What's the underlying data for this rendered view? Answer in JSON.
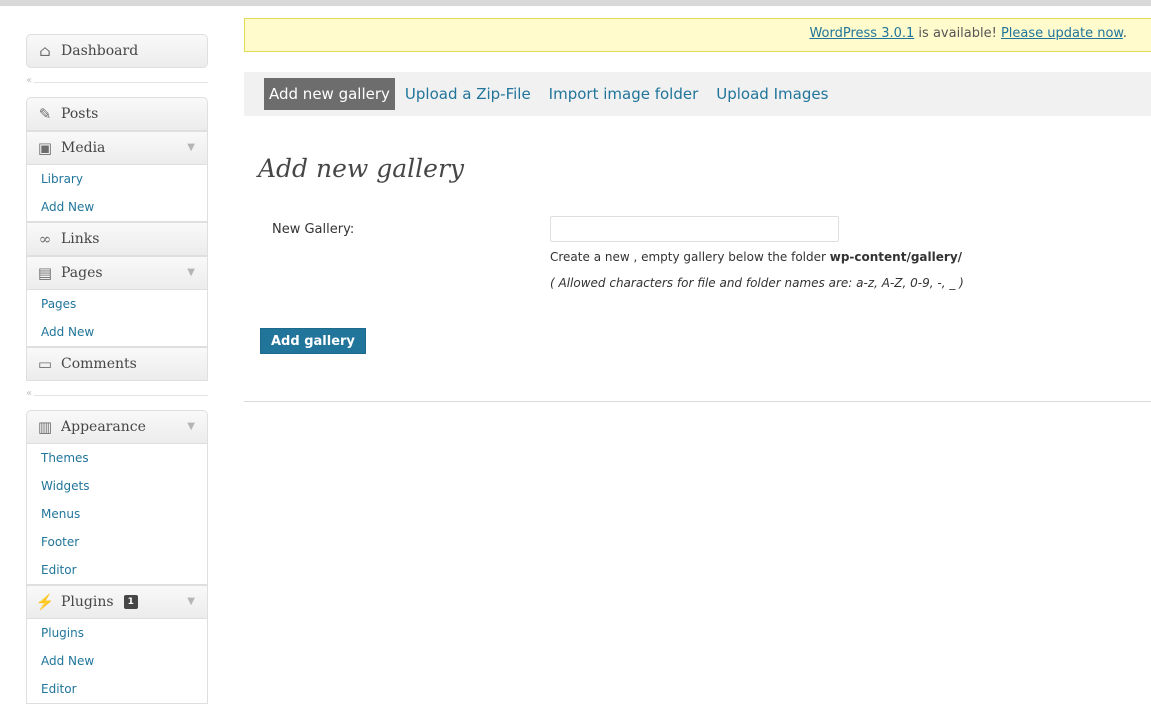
{
  "sidebar": {
    "dashboard": {
      "label": "Dashboard",
      "icon": "house-icon"
    },
    "collapse_glyph": "«",
    "posts": {
      "label": "Posts",
      "icon": "pushpin-icon"
    },
    "media": {
      "label": "Media",
      "icon": "camera-icon",
      "items": [
        "Library",
        "Add New"
      ]
    },
    "links": {
      "label": "Links",
      "icon": "chain-link-icon"
    },
    "pages": {
      "label": "Pages",
      "icon": "pages-icon",
      "items": [
        "Pages",
        "Add New"
      ]
    },
    "comments": {
      "label": "Comments",
      "icon": "speech-bubble-icon"
    },
    "appearance": {
      "label": "Appearance",
      "icon": "appearance-icon",
      "items": [
        "Themes",
        "Widgets",
        "Menus",
        "Footer",
        "Editor"
      ]
    },
    "plugins": {
      "label": "Plugins",
      "icon": "plug-icon",
      "badge": "1",
      "items": [
        "Plugins",
        "Add New",
        "Editor"
      ]
    }
  },
  "nag": {
    "link1": "WordPress 3.0.1",
    "middle": " is available! ",
    "link2": "Please update now",
    "end": "."
  },
  "tabs": [
    "Add new gallery",
    "Upload a Zip-File",
    "Import image folder",
    "Upload Images"
  ],
  "form": {
    "title": "Add new gallery",
    "label": "New Gallery:",
    "value": "",
    "help_prefix": "Create a new , empty gallery below the folder ",
    "help_folder": "wp-content/gallery/",
    "allowed": "( Allowed characters for file and folder names are: a-z, A-Z, 0-9, -, _ )",
    "button": "Add gallery"
  },
  "colors": {
    "link": "#21759b",
    "nag_bg": "#fffbcc",
    "active_tab": "#6d6d6d"
  }
}
